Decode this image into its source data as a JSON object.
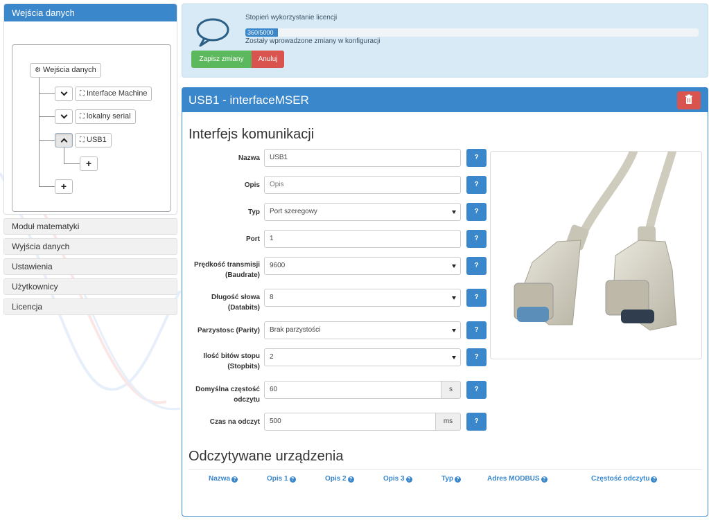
{
  "sidebar": {
    "panel_title": "Wejścia danych",
    "tree": {
      "root_label": "Wejścia danych",
      "nodes": [
        {
          "label": "Interface Machine"
        },
        {
          "label": "lokalny serial"
        },
        {
          "label": "USB1"
        }
      ]
    },
    "menu": [
      {
        "label": "Moduł matematyki"
      },
      {
        "label": "Wyjścia danych"
      },
      {
        "label": "Ustawienia"
      },
      {
        "label": "Użytkownicy"
      },
      {
        "label": "Licencja"
      }
    ]
  },
  "license": {
    "title": "Stopień wykorzystanie licencji",
    "progress_text": "360/5000",
    "progress_fraction": 0.072,
    "note": "Zostały wprowadzone zmiany w konfiguracji",
    "save_label": "Zapisz zmiany",
    "cancel_label": "Anuluj"
  },
  "main": {
    "title": "USB1 - interfaceMSER",
    "section1": "Interfejs komunikacji",
    "section2": "Odczytywane urządzenia",
    "help_label": "?",
    "fields": {
      "nazwa": {
        "label": "Nazwa",
        "value": "USB1"
      },
      "opis": {
        "label": "Opis",
        "placeholder": "Opis"
      },
      "typ": {
        "label": "Typ",
        "value": "Port szeregowy"
      },
      "port": {
        "label": "Port",
        "value": "1"
      },
      "baud": {
        "label1": "Prędkość transmisji",
        "label2": "(Baudrate)",
        "value": "9600"
      },
      "databits": {
        "label1": "Długość słowa",
        "label2": "(Databits)",
        "value": "8"
      },
      "parity": {
        "label": "Parzystosc (Parity)",
        "value": "Brak parzystości"
      },
      "stopbits": {
        "label1": "Ilość bitów stopu",
        "label2": "(Stopbits)",
        "value": "2"
      },
      "freq": {
        "label1": "Domyślna częstość",
        "label2": "odczytu",
        "value": "60",
        "unit": "s"
      },
      "timeout": {
        "label": "Czas na odczyt",
        "value": "500",
        "unit": "ms"
      }
    },
    "table_headers": [
      "Nazwa",
      "Opis 1",
      "Opis 2",
      "Opis 3",
      "Typ",
      "Adres MODBUS",
      "Częstość odczytu"
    ]
  },
  "colors": {
    "primary": "#3a87cc",
    "success": "#5cb85c",
    "danger": "#d9534f",
    "info_bg": "#d7eaf5"
  }
}
